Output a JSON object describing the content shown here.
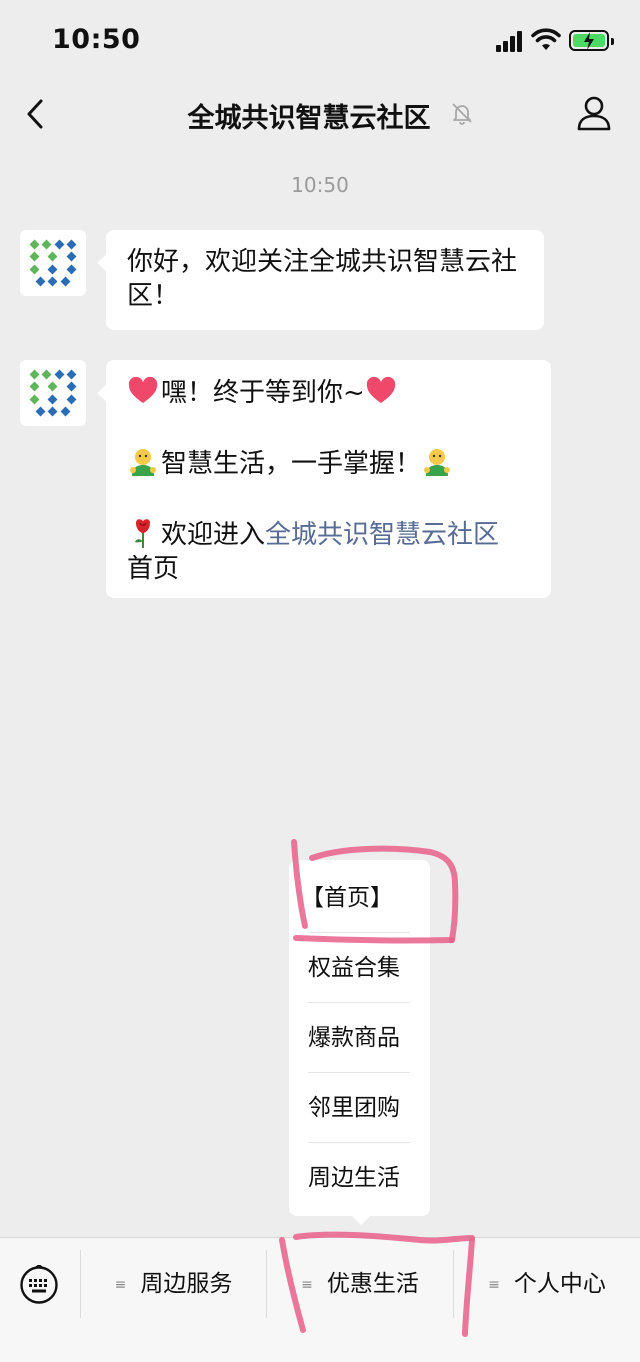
{
  "status_bar": {
    "time": "10:50"
  },
  "nav": {
    "title": "全城共识智慧云社区"
  },
  "chat": {
    "timestamp": "10:50",
    "messages": [
      {
        "text": "你好，欢迎关注全城共识智慧云社区！"
      },
      {
        "line1": "嘿！终于等到你~",
        "line2": "智慧生活，一手掌握！",
        "line3_prefix": "欢迎进入",
        "line3_link": "全城共识智慧云社区",
        "line3_suffix": "首页"
      }
    ]
  },
  "popup_menu": {
    "items": [
      {
        "label": "【首页】"
      },
      {
        "label": "权益合集"
      },
      {
        "label": "爆款商品"
      },
      {
        "label": "邻里团购"
      },
      {
        "label": "周边生活"
      }
    ]
  },
  "menu_bar": {
    "buttons": [
      {
        "label": "周边服务"
      },
      {
        "label": "优惠生活"
      },
      {
        "label": "个人中心"
      }
    ]
  },
  "icons": {
    "back": "chevron-left-icon",
    "mute": "bell-off-icon",
    "profile": "person-icon",
    "keyboard": "keyboard-icon",
    "list": "list-icon",
    "heart": "heart-emoji",
    "person": "person-emoji",
    "rose": "rose-emoji"
  },
  "colors": {
    "background": "#ededed",
    "bubble": "#ffffff",
    "link": "#576b95",
    "annotation": "#e8608a",
    "battery": "#4cd964"
  }
}
